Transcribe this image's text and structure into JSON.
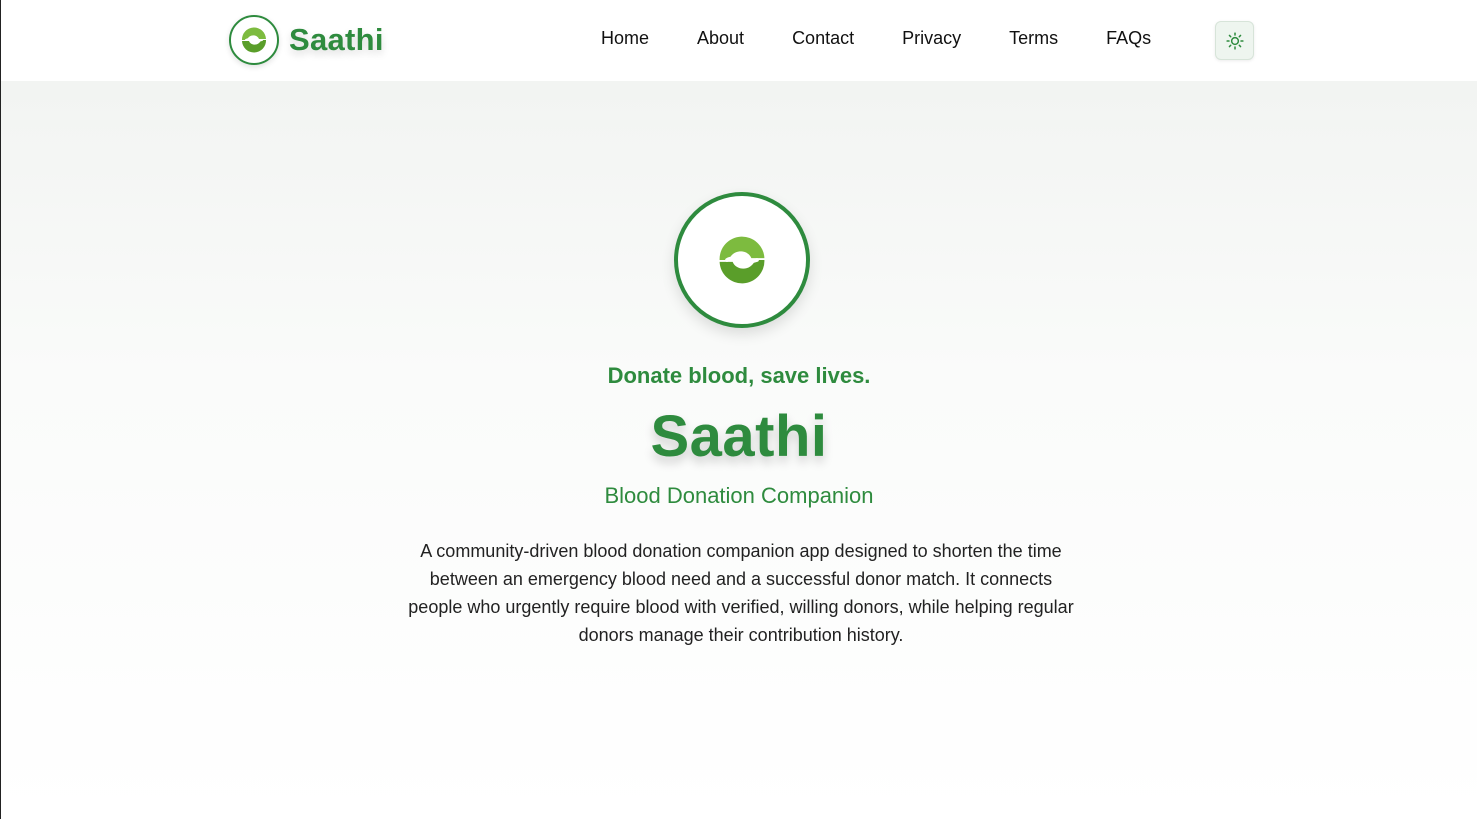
{
  "brand": {
    "name": "Saathi",
    "logo_icon": "saathi-hands-logo-icon"
  },
  "nav": {
    "links": [
      {
        "label": "Home"
      },
      {
        "label": "About"
      },
      {
        "label": "Contact"
      },
      {
        "label": "Privacy"
      },
      {
        "label": "Terms"
      },
      {
        "label": "FAQs"
      }
    ],
    "theme_toggle_icon": "sun-icon"
  },
  "hero": {
    "tagline": "Donate blood, save lives.",
    "title": "Saathi",
    "subtitle": "Blood Donation Companion",
    "description": "A community-driven blood donation companion app designed to shorten the time between an emergency blood need and a successful donor match. It connects people who urgently require blood with verified, willing donors, while helping regular donors manage their contribution history."
  },
  "colors": {
    "brand_green": "#2e8b3e",
    "logo_green": "#7dbb3f",
    "logo_green_dark": "#5a9e2a"
  }
}
